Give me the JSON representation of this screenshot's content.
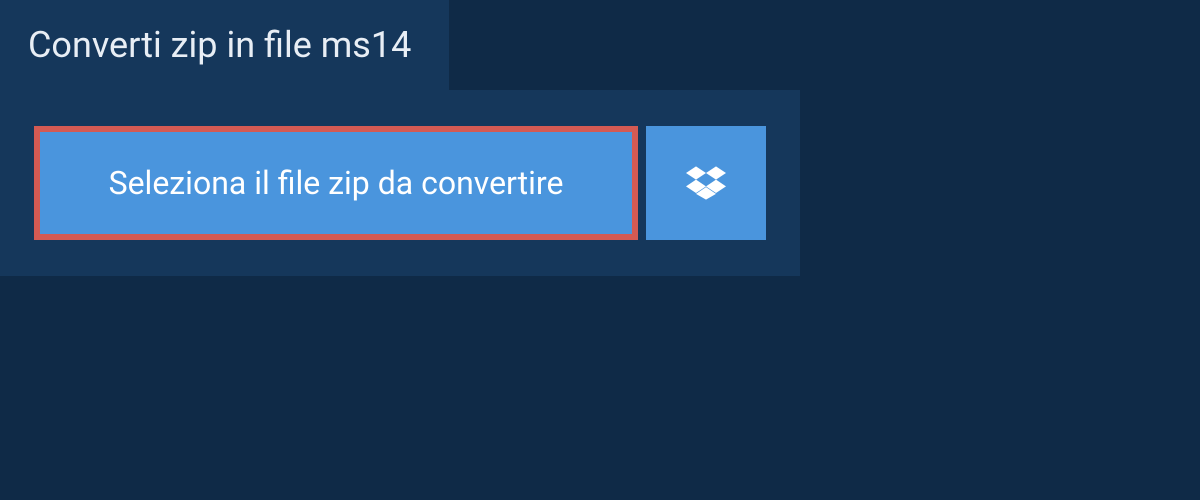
{
  "header": {
    "title": "Converti zip in file ms14"
  },
  "actions": {
    "select_file_label": "Seleziona il file zip da convertire"
  },
  "colors": {
    "background": "#0f2a47",
    "panel": "#15375b",
    "button": "#4a95dd",
    "highlight_border": "#d45a53",
    "text": "#e8eef5"
  }
}
